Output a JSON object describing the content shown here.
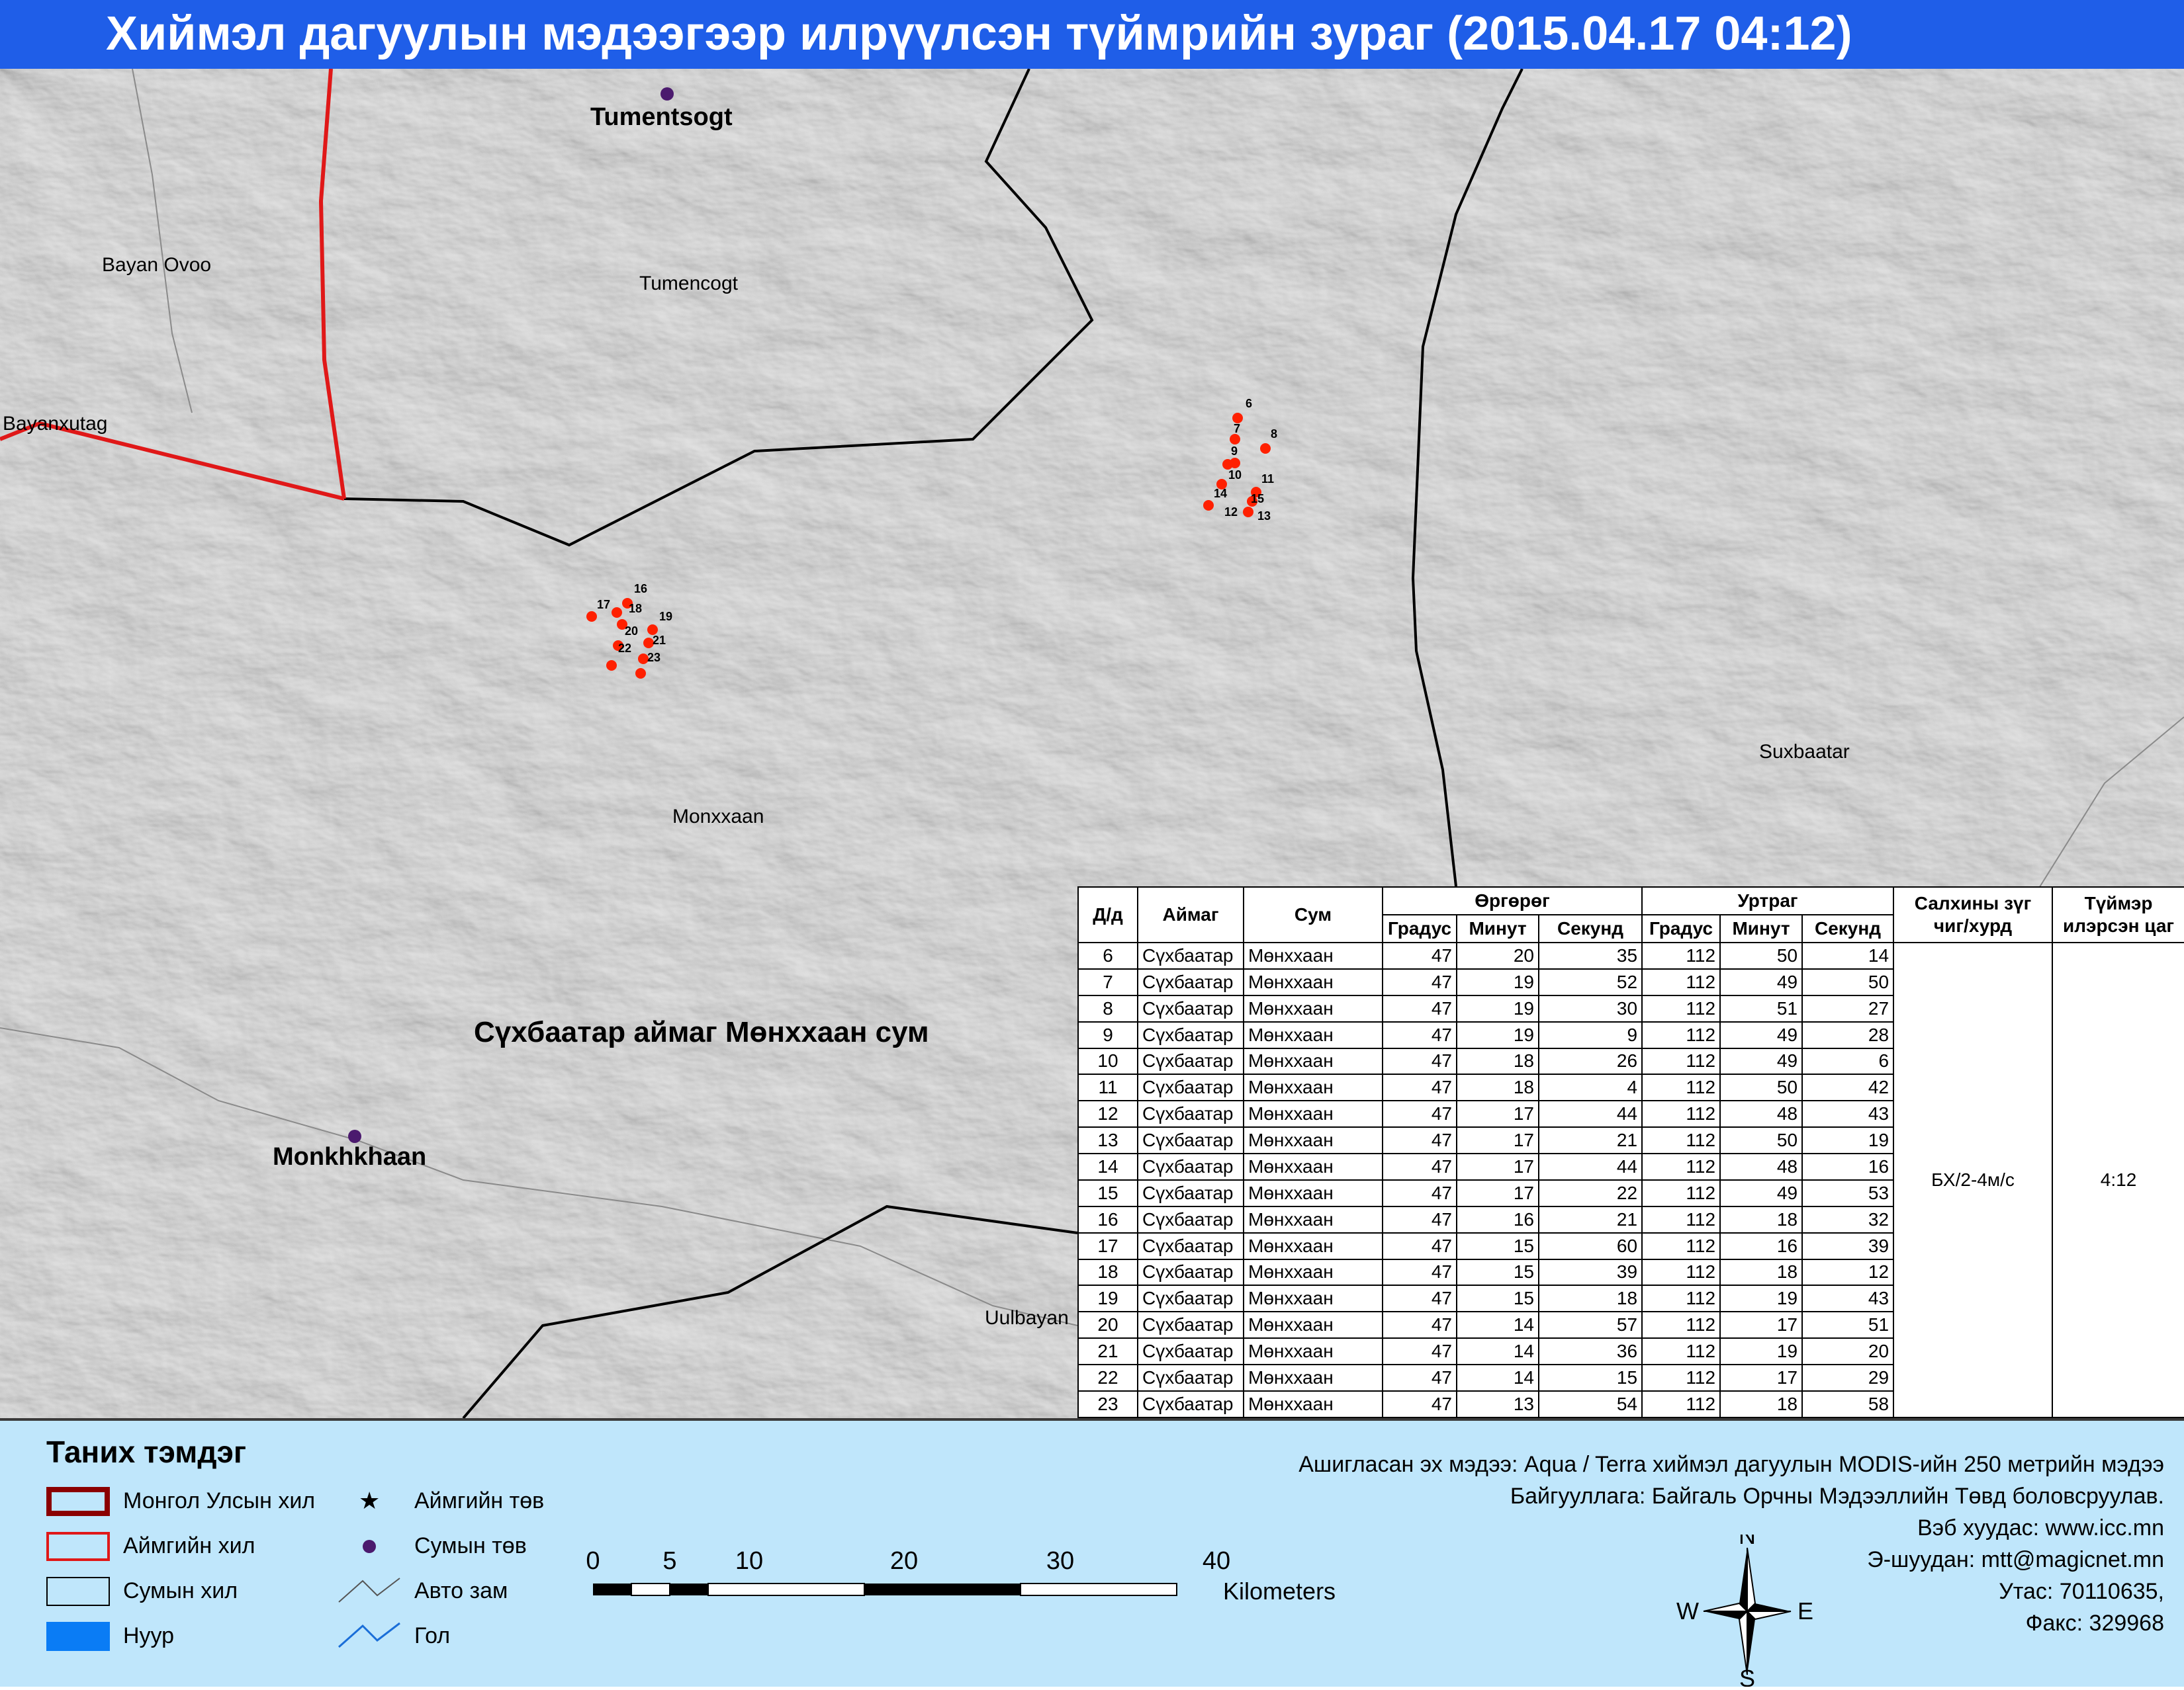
{
  "title": "Хиймэл дагуулын мэдээгээр илрүүлсэн түймрийн зураг  (2015.04.17 04:12)",
  "colors": {
    "title_bg": "#1f5ee8",
    "legend_bg": "#bfe6fb",
    "fire_point": "#ff2000",
    "sum_center": "#4b1a6e",
    "aimag_border": "#e01818",
    "country_border": "#8b0000",
    "sum_border": "#000000",
    "lake": "#0a7cf5"
  },
  "map": {
    "place_labels": {
      "tumentsogt": "Tumentsogt",
      "bayan_ovoo": "Bayan Ovoo",
      "tumencogt": "Tumencogt",
      "bayanxutag": "Bayanxutag",
      "suxbaatar": "Suxbaatar",
      "monxxaan": "Monxxaan",
      "region": "Сүхбаатар аймаг Мөнххаан сум",
      "monkhkhaan": "Monkhkhaan",
      "uulbayan": "Uulbayan"
    },
    "fire_points": [
      {
        "id": "6",
        "label": "6"
      },
      {
        "id": "7",
        "label": "7"
      },
      {
        "id": "8",
        "label": "8"
      },
      {
        "id": "9",
        "label": "9"
      },
      {
        "id": "10",
        "label": "10"
      },
      {
        "id": "11",
        "label": "11"
      },
      {
        "id": "12",
        "label": "12"
      },
      {
        "id": "13",
        "label": "13"
      },
      {
        "id": "14",
        "label": "14"
      },
      {
        "id": "15",
        "label": "15"
      },
      {
        "id": "16",
        "label": "16"
      },
      {
        "id": "17",
        "label": "17"
      },
      {
        "id": "18",
        "label": "18"
      },
      {
        "id": "19",
        "label": "19"
      },
      {
        "id": "20",
        "label": "20"
      },
      {
        "id": "21",
        "label": "21"
      },
      {
        "id": "22",
        "label": "22"
      },
      {
        "id": "23",
        "label": "23"
      }
    ]
  },
  "table": {
    "headers": {
      "dd": "Д/д",
      "aimag": "Аймаг",
      "sum": "Сум",
      "latitude": "Өргөрөг",
      "longitude": "Уртраг",
      "degree": "Градус",
      "minute": "Минут",
      "second": "Секунд",
      "wind": "Салхины зүг чиг/хурд",
      "time": "Түймэр илэрсэн цаг"
    },
    "wind_value": "БХ/2-4м/с",
    "time_value": "4:12",
    "rows": [
      {
        "dd": "6",
        "aimag": "Сүхбаатар",
        "sum": "Мөнххаан",
        "lat_d": "47",
        "lat_m": "20",
        "lat_s": "35",
        "lon_d": "112",
        "lon_m": "50",
        "lon_s": "14"
      },
      {
        "dd": "7",
        "aimag": "Сүхбаатар",
        "sum": "Мөнххаан",
        "lat_d": "47",
        "lat_m": "19",
        "lat_s": "52",
        "lon_d": "112",
        "lon_m": "49",
        "lon_s": "50"
      },
      {
        "dd": "8",
        "aimag": "Сүхбаатар",
        "sum": "Мөнххаан",
        "lat_d": "47",
        "lat_m": "19",
        "lat_s": "30",
        "lon_d": "112",
        "lon_m": "51",
        "lon_s": "27"
      },
      {
        "dd": "9",
        "aimag": "Сүхбаатар",
        "sum": "Мөнххаан",
        "lat_d": "47",
        "lat_m": "19",
        "lat_s": "9",
        "lon_d": "112",
        "lon_m": "49",
        "lon_s": "28"
      },
      {
        "dd": "10",
        "aimag": "Сүхбаатар",
        "sum": "Мөнххаан",
        "lat_d": "47",
        "lat_m": "18",
        "lat_s": "26",
        "lon_d": "112",
        "lon_m": "49",
        "lon_s": "6"
      },
      {
        "dd": "11",
        "aimag": "Сүхбаатар",
        "sum": "Мөнххаан",
        "lat_d": "47",
        "lat_m": "18",
        "lat_s": "4",
        "lon_d": "112",
        "lon_m": "50",
        "lon_s": "42"
      },
      {
        "dd": "12",
        "aimag": "Сүхбаатар",
        "sum": "Мөнххаан",
        "lat_d": "47",
        "lat_m": "17",
        "lat_s": "44",
        "lon_d": "112",
        "lon_m": "48",
        "lon_s": "43"
      },
      {
        "dd": "13",
        "aimag": "Сүхбаатар",
        "sum": "Мөнххаан",
        "lat_d": "47",
        "lat_m": "17",
        "lat_s": "21",
        "lon_d": "112",
        "lon_m": "50",
        "lon_s": "19"
      },
      {
        "dd": "14",
        "aimag": "Сүхбаатар",
        "sum": "Мөнххаан",
        "lat_d": "47",
        "lat_m": "17",
        "lat_s": "44",
        "lon_d": "112",
        "lon_m": "48",
        "lon_s": "16"
      },
      {
        "dd": "15",
        "aimag": "Сүхбаатар",
        "sum": "Мөнххаан",
        "lat_d": "47",
        "lat_m": "17",
        "lat_s": "22",
        "lon_d": "112",
        "lon_m": "49",
        "lon_s": "53"
      },
      {
        "dd": "16",
        "aimag": "Сүхбаатар",
        "sum": "Мөнххаан",
        "lat_d": "47",
        "lat_m": "16",
        "lat_s": "21",
        "lon_d": "112",
        "lon_m": "18",
        "lon_s": "32"
      },
      {
        "dd": "17",
        "aimag": "Сүхбаатар",
        "sum": "Мөнххаан",
        "lat_d": "47",
        "lat_m": "15",
        "lat_s": "60",
        "lon_d": "112",
        "lon_m": "16",
        "lon_s": "39"
      },
      {
        "dd": "18",
        "aimag": "Сүхбаатар",
        "sum": "Мөнххаан",
        "lat_d": "47",
        "lat_m": "15",
        "lat_s": "39",
        "lon_d": "112",
        "lon_m": "18",
        "lon_s": "12"
      },
      {
        "dd": "19",
        "aimag": "Сүхбаатар",
        "sum": "Мөнххаан",
        "lat_d": "47",
        "lat_m": "15",
        "lat_s": "18",
        "lon_d": "112",
        "lon_m": "19",
        "lon_s": "43"
      },
      {
        "dd": "20",
        "aimag": "Сүхбаатар",
        "sum": "Мөнххаан",
        "lat_d": "47",
        "lat_m": "14",
        "lat_s": "57",
        "lon_d": "112",
        "lon_m": "17",
        "lon_s": "51"
      },
      {
        "dd": "21",
        "aimag": "Сүхбаатар",
        "sum": "Мөнххаан",
        "lat_d": "47",
        "lat_m": "14",
        "lat_s": "36",
        "lon_d": "112",
        "lon_m": "19",
        "lon_s": "20"
      },
      {
        "dd": "22",
        "aimag": "Сүхбаатар",
        "sum": "Мөнххаан",
        "lat_d": "47",
        "lat_m": "14",
        "lat_s": "15",
        "lon_d": "112",
        "lon_m": "17",
        "lon_s": "29"
      },
      {
        "dd": "23",
        "aimag": "Сүхбаатар",
        "sum": "Мөнххаан",
        "lat_d": "47",
        "lat_m": "13",
        "lat_s": "54",
        "lon_d": "112",
        "lon_m": "18",
        "lon_s": "58"
      }
    ]
  },
  "legend": {
    "title": "Таних тэмдэг",
    "items": {
      "country_border": "Монгол Улсын хил",
      "aimag_border": "Аймгийн хил",
      "sum_border": "Сумын хил",
      "lake": "Нуур",
      "aimag_center": "Аймгийн төв",
      "sum_center": "Сумын төв",
      "road": "Авто зам",
      "river": "Гол"
    }
  },
  "scale": {
    "ticks": [
      "0",
      "5",
      "10",
      "20",
      "30",
      "40"
    ],
    "unit": "Kilometers"
  },
  "compass": {
    "n": "N",
    "s": "S",
    "e": "E",
    "w": "W"
  },
  "credits": {
    "source": "Ашигласан эх мэдээ: Aqua / Terra хиймэл дагуулын MODIS-ийн 250 метрийн мэдээ",
    "org": "Байгууллага: Байгаль Орчны Мэдээллийн Төвд боловсруулав.",
    "web": "Вэб хуудас: www.icc.mn",
    "email": "Э-шуудан: mtt@magicnet.mn",
    "phone": "Утас: 70110635,",
    "fax": "Факс: 329968"
  }
}
